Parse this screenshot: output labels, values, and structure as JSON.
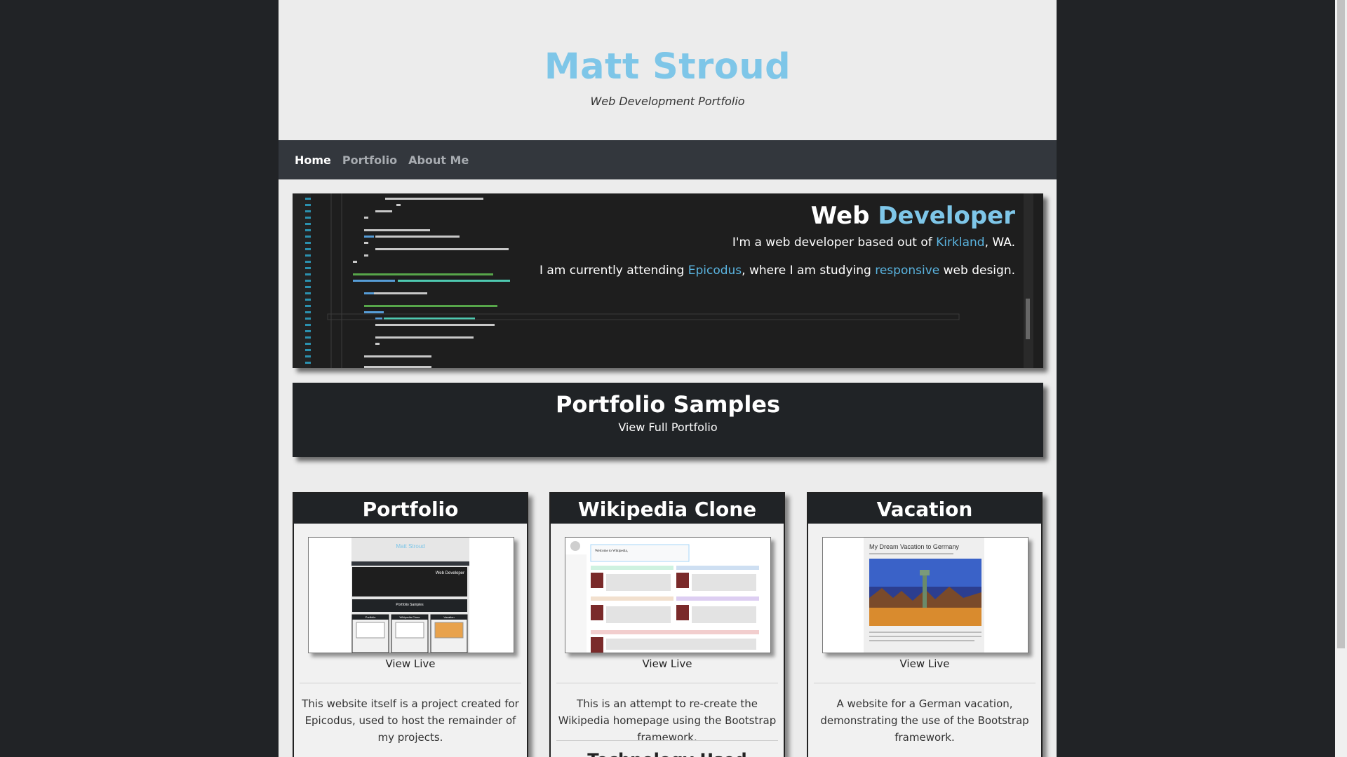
{
  "header": {
    "title": "Matt Stroud",
    "subtitle": "Web Development Portfolio"
  },
  "nav": {
    "items": [
      {
        "label": "Home",
        "active": true
      },
      {
        "label": "Portfolio",
        "active": false
      },
      {
        "label": "About Me",
        "active": false
      }
    ]
  },
  "hero": {
    "title_part1": "Web",
    "title_part2": "Developer",
    "line1_prefix": "I'm a web developer based out of",
    "line1_link": "Kirkland",
    "line1_suffix": ", WA.",
    "line2_prefix": "I am currently attending",
    "line2_link1": "Epicodus",
    "line2_mid": ", where I am studying",
    "line2_link2": "responsive",
    "line2_suffix": "web design."
  },
  "samples": {
    "title": "Portfolio Samples",
    "link": "View Full Portfolio"
  },
  "cards": [
    {
      "title": "Portfolio",
      "view_live": "View Live",
      "description": "This website itself is a project created for Epicodus, used to host the remainder of my projects.",
      "thumb": {
        "title": "Matt Stroud",
        "hero_title": "Web Developer",
        "samples_title": "Portfolio Samples",
        "cards": [
          "Portfolio",
          "Wikipedia Clone",
          "Vacation"
        ]
      }
    },
    {
      "title": "Wikipedia Clone",
      "view_live": "View Live",
      "description": "This is an attempt to re-create the Wikipedia homepage using the Bootstrap framework.",
      "section_partial": "Technology Used",
      "thumb": {
        "heading": "Welcome to Wikipedia,"
      }
    },
    {
      "title": "Vacation",
      "view_live": "View Live",
      "description": "A website for a German vacation, demonstrating the use of the Bootstrap framework.",
      "thumb": {
        "title": "My Dream Vacation to Germany"
      }
    }
  ],
  "colors": {
    "accent": "#7ec6e8",
    "link": "#5ab4e0",
    "dark": "#202326",
    "nav": "#33373d",
    "page": "#ececec"
  }
}
